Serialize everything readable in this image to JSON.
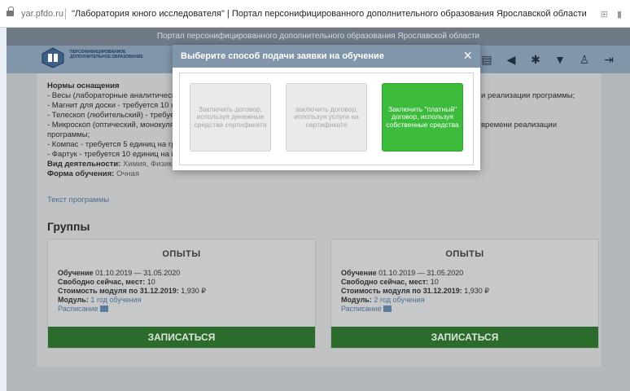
{
  "browser": {
    "domain": "yar.pfdo.ru",
    "tab_title": "\"Лаборатория юного исследователя\" | Портал персонифицированного дополнительного образования Ярославской области"
  },
  "site": {
    "top_strip": "Портал персонифицированного дополнительного образования Ярославской области",
    "logo_text": "ПЕРСОНИФИЦИРОВАННОЕ ДОПОЛНИТЕЛЬНОЕ ОБРАЗОВАНИЕ",
    "header_icons": [
      "document-icon",
      "megaphone-icon",
      "asterisk-icon",
      "trophy-icon",
      "people-icon",
      "logout-icon"
    ]
  },
  "program": {
    "equipment_heading": "Нормы оснащения",
    "equipment": [
      "- Весы (лабораторные аналитические) ...",
      "- Магнит для доски - требуется 10 ш...",
      "- Телескоп (любительский) - требует...",
      "- Микроскоп (оптический, монокуля...",
      "программы;",
      "- Компас - требуется 5 единиц на гру...",
      "- Фартук - требуется 10 единиц на гр..."
    ],
    "equipment_right": [
      "и реализации программы;",
      "",
      "",
      "времени реализации",
      "",
      "",
      ""
    ],
    "activity_label": "Вид деятельности:",
    "activity_value": "Химия, Физика...",
    "form_label": "Форма обучения:",
    "form_value": "Очная",
    "program_text_link": "Текст программы",
    "groups_heading": "Группы"
  },
  "groups": [
    {
      "title": "ОПЫТЫ",
      "study_label": "Обучение",
      "study_value": "01.10.2019 — 31.05.2020",
      "free_label": "Свободно сейчас, мест:",
      "free_value": "10",
      "cost_label": "Стоимость модуля по 31.12.2019:",
      "cost_value": "1,930 ₽",
      "module_label": "Модуль:",
      "module_value": "1 год обучения",
      "schedule_link": "Расписание",
      "enroll_button": "ЗАПИСАТЬСЯ"
    },
    {
      "title": "ОПЫТЫ",
      "study_label": "Обучение",
      "study_value": "01.10.2019 — 31.05.2020",
      "free_label": "Свободно сейчас, мест:",
      "free_value": "10",
      "cost_label": "Стоимость модуля по 31.12.2019:",
      "cost_value": "1,930 ₽",
      "module_label": "Модуль:",
      "module_value": "2 год обучения",
      "schedule_link": "Расписание",
      "enroll_button": "ЗАПИСАТЬСЯ"
    }
  ],
  "modal": {
    "title": "Выберите способ подачи заявки на обучение",
    "close_glyph": "×",
    "options": [
      {
        "label": "Заключить договор, используя денежные средства сертификата",
        "state": "disabled"
      },
      {
        "label": "заключить договор, используя услуги на сертификате",
        "state": "disabled"
      },
      {
        "label": "Заключить \"платный\" договор, используя собственные средства",
        "state": "active"
      }
    ]
  },
  "colors": {
    "header_bg": "#8196ab",
    "enroll_green": "#2b6b2b",
    "active_option_green": "#3dbb3d"
  }
}
